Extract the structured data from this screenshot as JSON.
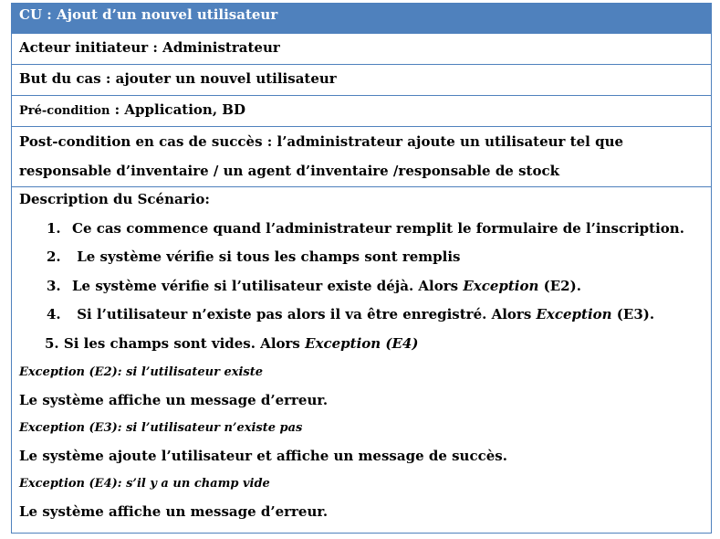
{
  "title": "CU : Ajout d’un nouvel utilisateur",
  "actor": "Acteur initiateur : Administrateur",
  "goal": "But du cas : ajouter un nouvel  utilisateur",
  "precondition": {
    "label": "Pré-condition",
    "value": " : Application, BD"
  },
  "postcondition": {
    "line1": "Post-condition en cas de succès : l’administrateur  ajoute un utilisateur tel que",
    "line2": "responsable d’inventaire / un agent d’inventaire  /responsable de stock"
  },
  "scenario": {
    "heading": "Description du Scénario:",
    "steps": [
      {
        "num": "1.",
        "text": "Ce cas commence quand l’administrateur remplit le formulaire de l’inscription."
      },
      {
        "num": "2.",
        "text": " Le système vérifie si tous les champs sont remplis"
      },
      {
        "num": "3.",
        "text": "Le système vérifie si l’utilisateur existe déjà. Alors ",
        "exception": "Exception",
        "after": " (E2)."
      },
      {
        "num": "4.",
        "text": "  Si l’utilisateur n’existe pas  alors il va être enregistré. Alors ",
        "exception": "Exception",
        "after": " (E3)."
      },
      {
        "num": "5.",
        "text": " Si les champs sont  vides. Alors ",
        "exception": "Exception (E4)"
      }
    ]
  },
  "exceptions": [
    {
      "label": "Exception (E2): si l’utilisateur existe",
      "result": "Le système affiche un message d’erreur."
    },
    {
      "label": "Exception (E3): si l’utilisateur n’existe pas",
      "result": "Le système ajoute l’utilisateur et affiche un message de succès."
    },
    {
      "label": "Exception (E4): s’il y a un champ vide",
      "result": "Le système affiche un message d’erreur."
    }
  ]
}
